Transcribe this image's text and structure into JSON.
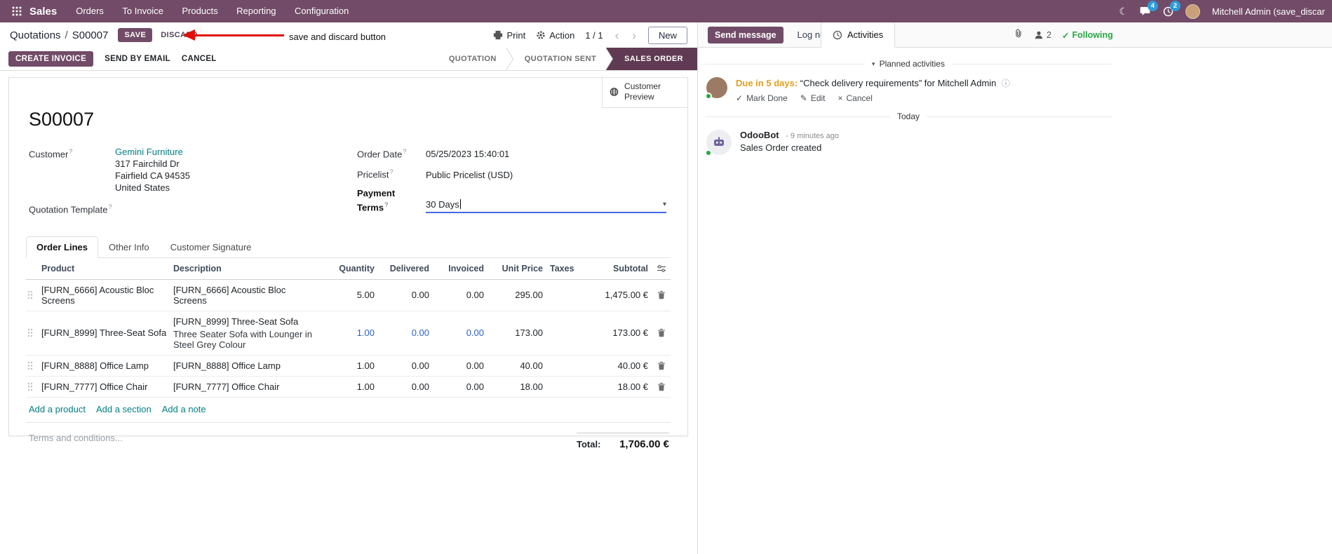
{
  "navbar": {
    "app_name": "Sales",
    "menus": [
      "Orders",
      "To Invoice",
      "Products",
      "Reporting",
      "Configuration"
    ],
    "chat_badge": "4",
    "activity_badge": "2",
    "user_name": "Mitchell Admin (save_discar"
  },
  "control": {
    "breadcrumb_parent": "Quotations",
    "breadcrumb_separator": "/",
    "breadcrumb_current": "S00007",
    "save": "SAVE",
    "discard": "DISCARD",
    "print": "Print",
    "action": "Action",
    "pager": "1 / 1",
    "new": "New"
  },
  "annotation": {
    "label": "save and discard button"
  },
  "statusbar": {
    "create_invoice": "CREATE INVOICE",
    "send_by_email": "SEND BY EMAIL",
    "cancel": "CANCEL",
    "stages": [
      {
        "label": "QUOTATION",
        "active": false
      },
      {
        "label": "QUOTATION SENT",
        "active": false
      },
      {
        "label": "SALES ORDER",
        "active": true
      }
    ]
  },
  "sheet": {
    "customer_preview": "Customer Preview",
    "name": "S00007",
    "help_marker": "?",
    "customer": {
      "label": "Customer",
      "name": "Gemini Furniture",
      "street": "317 Fairchild Dr",
      "city": "Fairfield CA 94535",
      "country": "United States"
    },
    "quotation_template_label": "Quotation Template",
    "order_date": {
      "label": "Order Date",
      "value": "05/25/2023 15:40:01"
    },
    "pricelist": {
      "label": "Pricelist",
      "value": "Public Pricelist (USD)"
    },
    "payment_terms": {
      "label": "Payment Terms",
      "value": "30 Days"
    },
    "tabs": {
      "order_lines": "Order Lines",
      "other_info": "Other Info",
      "customer_signature": "Customer Signature"
    },
    "table": {
      "headers": {
        "product": "Product",
        "description": "Description",
        "quantity": "Quantity",
        "delivered": "Delivered",
        "invoiced": "Invoiced",
        "unit_price": "Unit Price",
        "taxes": "Taxes",
        "subtotal": "Subtotal"
      },
      "rows": [
        {
          "product": "[FURN_6666] Acoustic Bloc Screens",
          "description": "[FURN_6666] Acoustic Bloc Screens",
          "quantity": "5.00",
          "delivered": "0.00",
          "invoiced": "0.00",
          "unit_price": "295.00",
          "taxes": "",
          "subtotal": "1,475.00 €"
        },
        {
          "product": "[FURN_8999] Three-Seat Sofa",
          "description": "[FURN_8999] Three-Seat Sofa",
          "description2": "Three Seater Sofa with Lounger in Steel Grey Colour",
          "quantity": "1.00",
          "delivered": "0.00",
          "invoiced": "0.00",
          "unit_price": "173.00",
          "taxes": "",
          "subtotal": "173.00 €"
        },
        {
          "product": "[FURN_8888] Office Lamp",
          "description": "[FURN_8888] Office Lamp",
          "quantity": "1.00",
          "delivered": "0.00",
          "invoiced": "0.00",
          "unit_price": "40.00",
          "taxes": "",
          "subtotal": "40.00 €"
        },
        {
          "product": "[FURN_7777] Office Chair",
          "description": "[FURN_7777] Office Chair",
          "quantity": "1.00",
          "delivered": "0.00",
          "invoiced": "0.00",
          "unit_price": "18.00",
          "taxes": "",
          "subtotal": "18.00 €"
        }
      ],
      "add_product": "Add a product",
      "add_section": "Add a section",
      "add_note": "Add a note"
    },
    "terms_placeholder": "Terms and conditions...",
    "total_label": "Total:",
    "total_value": "1,706.00 €"
  },
  "chatter": {
    "send_message": "Send message",
    "log_note": "Log note",
    "activities": "Activities",
    "followers_count": "2",
    "following": "Following",
    "planned_activities": "Planned activities",
    "activity": {
      "due": "Due in 5 days:",
      "summary": "“Check delivery requirements”",
      "assignee": "for Mitchell Admin",
      "mark_done": "Mark Done",
      "edit": "Edit",
      "cancel": "Cancel"
    },
    "today": "Today",
    "message": {
      "author": "OdooBot",
      "time": "- 9 minutes ago",
      "body": "Sales Order created"
    }
  },
  "icons": {
    "chevron_left": "‹",
    "chevron_right": "›",
    "dropdown_caret": "▾",
    "section_caret": "▾",
    "check": "✓",
    "pencil": "✎",
    "cross": "×",
    "info": "ⓘ",
    "moon": "☾"
  },
  "colors": {
    "brand_purple": "#714B67",
    "stage_active": "#5f3a52",
    "link_teal": "#017e84",
    "edited_blue": "#2d61c9",
    "due_orange": "#dfa021",
    "following_green": "#28a745",
    "annotation_red": "#e01007",
    "badge_blue": "#2d9cdb"
  }
}
